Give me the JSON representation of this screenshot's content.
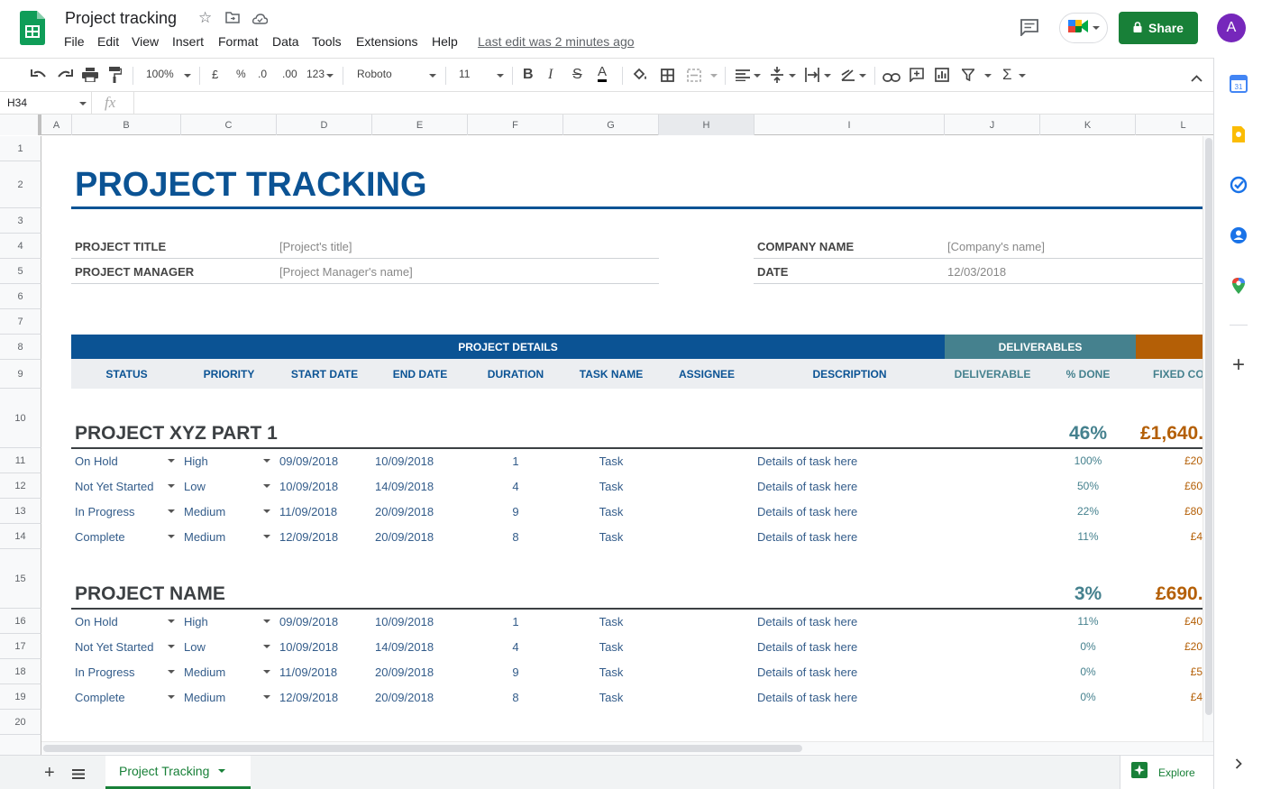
{
  "app": {
    "title": "Project tracking",
    "last_edit": "Last edit was 2 minutes ago",
    "share_label": "Share",
    "avatar_letter": "A"
  },
  "menu": [
    "File",
    "Edit",
    "View",
    "Insert",
    "Format",
    "Data",
    "Tools",
    "Extensions",
    "Help"
  ],
  "toolbar": {
    "zoom": "100%",
    "currency": "£",
    "percent": "%",
    "dec_less": ".0",
    "dec_more": ".00",
    "more_formats": "123",
    "font": "Roboto",
    "font_size": "11"
  },
  "formula_bar": {
    "cell_ref": "H34",
    "fx": "fx",
    "content": ""
  },
  "columns": [
    "A",
    "B",
    "C",
    "D",
    "E",
    "F",
    "G",
    "H",
    "I",
    "J",
    "K",
    "L"
  ],
  "rows": [
    "1",
    "2",
    "3",
    "4",
    "5",
    "6",
    "7",
    "8",
    "9",
    "10",
    "11",
    "12",
    "13",
    "14",
    "15",
    "16",
    "17",
    "18",
    "19",
    "20"
  ],
  "sheet": {
    "title": "PROJECT TRACKING",
    "info": {
      "project_title_label": "PROJECT TITLE",
      "project_title_value": "[Project's title]",
      "project_manager_label": "PROJECT MANAGER",
      "project_manager_value": "[Project Manager's name]",
      "company_label": "COMPANY NAME",
      "company_value": "[Company's name]",
      "date_label": "DATE",
      "date_value": "12/03/2018"
    },
    "bands": {
      "details": "PROJECT DETAILS",
      "deliverables": "DELIVERABLES"
    },
    "headers": [
      "STATUS",
      "PRIORITY",
      "START DATE",
      "END DATE",
      "DURATION",
      "TASK NAME",
      "ASSIGNEE",
      "DESCRIPTION",
      "DELIVERABLE",
      "% DONE",
      "FIXED COS"
    ],
    "sections": [
      {
        "name": "PROJECT XYZ PART 1",
        "pct": "46%",
        "cost": "£1,640.",
        "rows": [
          {
            "status": "On Hold",
            "priority": "High",
            "start": "09/09/2018",
            "end": "10/09/2018",
            "duration": "1",
            "task": "Task",
            "desc": "Details of task here",
            "done": "100%",
            "cost": "£20"
          },
          {
            "status": "Not Yet Started",
            "priority": "Low",
            "start": "10/09/2018",
            "end": "14/09/2018",
            "duration": "4",
            "task": "Task",
            "desc": "Details of task here",
            "done": "50%",
            "cost": "£60"
          },
          {
            "status": "In Progress",
            "priority": "Medium",
            "start": "11/09/2018",
            "end": "20/09/2018",
            "duration": "9",
            "task": "Task",
            "desc": "Details of task here",
            "done": "22%",
            "cost": "£80"
          },
          {
            "status": "Complete",
            "priority": "Medium",
            "start": "12/09/2018",
            "end": "20/09/2018",
            "duration": "8",
            "task": "Task",
            "desc": "Details of task here",
            "done": "11%",
            "cost": "£4"
          }
        ]
      },
      {
        "name": "PROJECT NAME",
        "pct": "3%",
        "cost": "£690.",
        "rows": [
          {
            "status": "On Hold",
            "priority": "High",
            "start": "09/09/2018",
            "end": "10/09/2018",
            "duration": "1",
            "task": "Task",
            "desc": "Details of task here",
            "done": "11%",
            "cost": "£40"
          },
          {
            "status": "Not Yet Started",
            "priority": "Low",
            "start": "10/09/2018",
            "end": "14/09/2018",
            "duration": "4",
            "task": "Task",
            "desc": "Details of task here",
            "done": "0%",
            "cost": "£20"
          },
          {
            "status": "In Progress",
            "priority": "Medium",
            "start": "11/09/2018",
            "end": "20/09/2018",
            "duration": "9",
            "task": "Task",
            "desc": "Details of task here",
            "done": "0%",
            "cost": "£5"
          },
          {
            "status": "Complete",
            "priority": "Medium",
            "start": "12/09/2018",
            "end": "20/09/2018",
            "duration": "8",
            "task": "Task",
            "desc": "Details of task here",
            "done": "0%",
            "cost": "£4"
          }
        ]
      }
    ]
  },
  "tabs": {
    "active": "Project Tracking",
    "explore": "Explore"
  },
  "colors": {
    "title_blue": "#0b5394",
    "teal": "#45818e",
    "orange": "#b45f06",
    "share_green": "#188038"
  }
}
